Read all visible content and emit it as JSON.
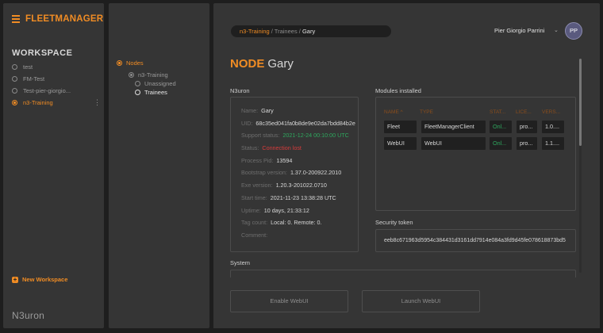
{
  "brand": {
    "name": "FLEETMANAGER",
    "accent": "#f08c24"
  },
  "workspace": {
    "title": "WORKSPACE",
    "items": [
      {
        "label": "test",
        "active": false
      },
      {
        "label": "FM-Test",
        "active": false
      },
      {
        "label": "Test-pier-giorgio...",
        "active": false
      },
      {
        "label": "n3-Training",
        "active": true
      }
    ],
    "kebab": "⋮",
    "new_label": "New Workspace",
    "new_icon": "+"
  },
  "logo": "N3uron",
  "tree": {
    "root": "Nodes",
    "group": "n3-Training",
    "children": [
      "Unassigned",
      "Trainees"
    ]
  },
  "breadcrumb": {
    "part1": "n3-Training",
    "sep": " / ",
    "part2": "Trainees",
    "part3": "Gary"
  },
  "user": {
    "name": "Pier Giorgio Parrini",
    "initials": "PP",
    "caret": "⌄"
  },
  "page": {
    "keyword": "NODE",
    "name": "Gary"
  },
  "info": {
    "section": "N3uron",
    "rows": [
      {
        "key": "Name:",
        "value": "Gary",
        "tone": ""
      },
      {
        "key": "UID:",
        "value": "68c35ed041fa0b8de9e02da7bdd84b2e",
        "tone": ""
      },
      {
        "key": "Support status:",
        "value": "2021-12-24 00:10:00 UTC",
        "tone": "green"
      },
      {
        "key": "Status:",
        "value": "Connection lost",
        "tone": "red"
      },
      {
        "key": "Process Pid:",
        "value": "13594",
        "tone": ""
      },
      {
        "key": "Bootstrap version:",
        "value": "1.37.0-200922.2010",
        "tone": ""
      },
      {
        "key": "Exe version:",
        "value": "1.20.3-201022.0710",
        "tone": ""
      },
      {
        "key": "Start time:",
        "value": "2021-11-23 13:38:28 UTC",
        "tone": ""
      },
      {
        "key": "Uptime:",
        "value": "10 days, 21:33:12",
        "tone": ""
      },
      {
        "key": "Tag count:",
        "value": "Local: 0. Remote: 0.",
        "tone": ""
      },
      {
        "key": "Comment:",
        "value": "",
        "tone": ""
      }
    ]
  },
  "modules": {
    "section": "Modules installed",
    "headers": [
      "NAME ^",
      "TYPE",
      "STAT...",
      "LICE...",
      "VERS..."
    ],
    "rows": [
      [
        "Fleet",
        "FleetManagerClient",
        "Onl...",
        "pro...",
        "1.0...."
      ],
      [
        "WebUI",
        "WebUI",
        "Onl...",
        "pro...",
        "1.1...."
      ]
    ]
  },
  "token": {
    "section": "Security token",
    "value": "eeb8c671963d5954c384431d3161dd7914e084a3fd9d45fe078618873bd5"
  },
  "system": {
    "section": "System"
  },
  "buttons": {
    "enable": "Enable WebUI",
    "launch": "Launch WebUI"
  }
}
